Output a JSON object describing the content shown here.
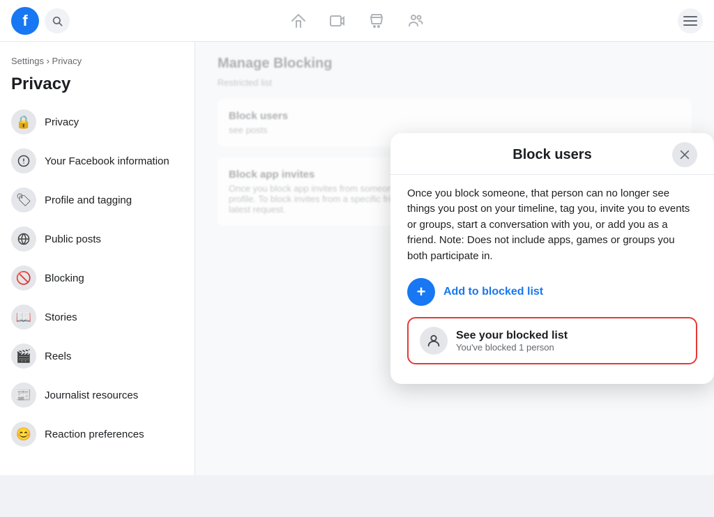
{
  "nav": {
    "search_icon": "🔍",
    "home_icon": "⌂",
    "video_icon": "▶",
    "store_icon": "🏪",
    "people_icon": "👥"
  },
  "sidebar": {
    "breadcrumb_settings": "Settings",
    "breadcrumb_separator": " › ",
    "breadcrumb_current": "Privacy",
    "title": "Privacy",
    "items": [
      {
        "id": "privacy",
        "label": "Privacy",
        "icon": "🔒"
      },
      {
        "id": "facebook-info",
        "label": "Your Facebook information",
        "icon": "ⓕ"
      },
      {
        "id": "profile-tagging",
        "label": "Profile and tagging",
        "icon": "🏷"
      },
      {
        "id": "public-posts",
        "label": "Public posts",
        "icon": "🌐"
      },
      {
        "id": "blocking",
        "label": "Blocking",
        "icon": "🚫"
      },
      {
        "id": "stories",
        "label": "Stories",
        "icon": "📖"
      },
      {
        "id": "reels",
        "label": "Reels",
        "icon": "🎬"
      },
      {
        "id": "journalist",
        "label": "Journalist resources",
        "icon": "📰"
      },
      {
        "id": "reactions",
        "label": "Reaction preferences",
        "icon": "😊"
      }
    ]
  },
  "main_content": {
    "section_title": "Manage Blocking",
    "restricted_list": "Restricted list",
    "block_users_section": "Block users",
    "block_users_desc": "Once you block app invites from someone's profile, you'll automatically ignore requests from that person's profile. To block invites from a specific friend's profile, click \"Ignore All Invites From This Profile\" link under your latest request.",
    "block_app_invites": "Block app invites"
  },
  "modal": {
    "title": "Block users",
    "close_label": "×",
    "body_text": "Once you block someone, that person can no longer see things you post on your timeline, tag you, invite you to events or groups, start a conversation with you, or add you as a friend. Note: Does not include apps, games or groups you both participate in.",
    "add_label": "Add to blocked list",
    "add_icon": "+",
    "blocked_list_title": "See your blocked list",
    "blocked_list_subtitle": "You've blocked 1 person",
    "blocked_icon": "👤"
  }
}
